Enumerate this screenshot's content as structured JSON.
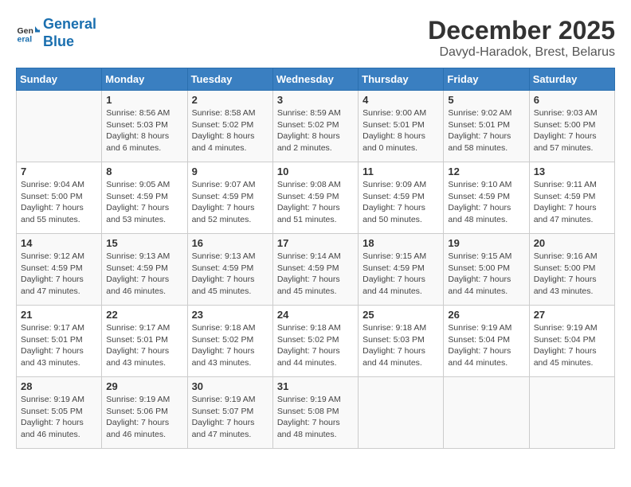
{
  "header": {
    "logo_line1": "General",
    "logo_line2": "Blue",
    "month": "December 2025",
    "location": "Davyd-Haradok, Brest, Belarus"
  },
  "days_of_week": [
    "Sunday",
    "Monday",
    "Tuesday",
    "Wednesday",
    "Thursday",
    "Friday",
    "Saturday"
  ],
  "weeks": [
    [
      {
        "day": "",
        "info": ""
      },
      {
        "day": "1",
        "info": "Sunrise: 8:56 AM\nSunset: 5:03 PM\nDaylight: 8 hours\nand 6 minutes."
      },
      {
        "day": "2",
        "info": "Sunrise: 8:58 AM\nSunset: 5:02 PM\nDaylight: 8 hours\nand 4 minutes."
      },
      {
        "day": "3",
        "info": "Sunrise: 8:59 AM\nSunset: 5:02 PM\nDaylight: 8 hours\nand 2 minutes."
      },
      {
        "day": "4",
        "info": "Sunrise: 9:00 AM\nSunset: 5:01 PM\nDaylight: 8 hours\nand 0 minutes."
      },
      {
        "day": "5",
        "info": "Sunrise: 9:02 AM\nSunset: 5:01 PM\nDaylight: 7 hours\nand 58 minutes."
      },
      {
        "day": "6",
        "info": "Sunrise: 9:03 AM\nSunset: 5:00 PM\nDaylight: 7 hours\nand 57 minutes."
      }
    ],
    [
      {
        "day": "7",
        "info": "Sunrise: 9:04 AM\nSunset: 5:00 PM\nDaylight: 7 hours\nand 55 minutes."
      },
      {
        "day": "8",
        "info": "Sunrise: 9:05 AM\nSunset: 4:59 PM\nDaylight: 7 hours\nand 53 minutes."
      },
      {
        "day": "9",
        "info": "Sunrise: 9:07 AM\nSunset: 4:59 PM\nDaylight: 7 hours\nand 52 minutes."
      },
      {
        "day": "10",
        "info": "Sunrise: 9:08 AM\nSunset: 4:59 PM\nDaylight: 7 hours\nand 51 minutes."
      },
      {
        "day": "11",
        "info": "Sunrise: 9:09 AM\nSunset: 4:59 PM\nDaylight: 7 hours\nand 50 minutes."
      },
      {
        "day": "12",
        "info": "Sunrise: 9:10 AM\nSunset: 4:59 PM\nDaylight: 7 hours\nand 48 minutes."
      },
      {
        "day": "13",
        "info": "Sunrise: 9:11 AM\nSunset: 4:59 PM\nDaylight: 7 hours\nand 47 minutes."
      }
    ],
    [
      {
        "day": "14",
        "info": "Sunrise: 9:12 AM\nSunset: 4:59 PM\nDaylight: 7 hours\nand 47 minutes."
      },
      {
        "day": "15",
        "info": "Sunrise: 9:13 AM\nSunset: 4:59 PM\nDaylight: 7 hours\nand 46 minutes."
      },
      {
        "day": "16",
        "info": "Sunrise: 9:13 AM\nSunset: 4:59 PM\nDaylight: 7 hours\nand 45 minutes."
      },
      {
        "day": "17",
        "info": "Sunrise: 9:14 AM\nSunset: 4:59 PM\nDaylight: 7 hours\nand 45 minutes."
      },
      {
        "day": "18",
        "info": "Sunrise: 9:15 AM\nSunset: 4:59 PM\nDaylight: 7 hours\nand 44 minutes."
      },
      {
        "day": "19",
        "info": "Sunrise: 9:15 AM\nSunset: 5:00 PM\nDaylight: 7 hours\nand 44 minutes."
      },
      {
        "day": "20",
        "info": "Sunrise: 9:16 AM\nSunset: 5:00 PM\nDaylight: 7 hours\nand 43 minutes."
      }
    ],
    [
      {
        "day": "21",
        "info": "Sunrise: 9:17 AM\nSunset: 5:01 PM\nDaylight: 7 hours\nand 43 minutes."
      },
      {
        "day": "22",
        "info": "Sunrise: 9:17 AM\nSunset: 5:01 PM\nDaylight: 7 hours\nand 43 minutes."
      },
      {
        "day": "23",
        "info": "Sunrise: 9:18 AM\nSunset: 5:02 PM\nDaylight: 7 hours\nand 43 minutes."
      },
      {
        "day": "24",
        "info": "Sunrise: 9:18 AM\nSunset: 5:02 PM\nDaylight: 7 hours\nand 44 minutes."
      },
      {
        "day": "25",
        "info": "Sunrise: 9:18 AM\nSunset: 5:03 PM\nDaylight: 7 hours\nand 44 minutes."
      },
      {
        "day": "26",
        "info": "Sunrise: 9:19 AM\nSunset: 5:04 PM\nDaylight: 7 hours\nand 44 minutes."
      },
      {
        "day": "27",
        "info": "Sunrise: 9:19 AM\nSunset: 5:04 PM\nDaylight: 7 hours\nand 45 minutes."
      }
    ],
    [
      {
        "day": "28",
        "info": "Sunrise: 9:19 AM\nSunset: 5:05 PM\nDaylight: 7 hours\nand 46 minutes."
      },
      {
        "day": "29",
        "info": "Sunrise: 9:19 AM\nSunset: 5:06 PM\nDaylight: 7 hours\nand 46 minutes."
      },
      {
        "day": "30",
        "info": "Sunrise: 9:19 AM\nSunset: 5:07 PM\nDaylight: 7 hours\nand 47 minutes."
      },
      {
        "day": "31",
        "info": "Sunrise: 9:19 AM\nSunset: 5:08 PM\nDaylight: 7 hours\nand 48 minutes."
      },
      {
        "day": "",
        "info": ""
      },
      {
        "day": "",
        "info": ""
      },
      {
        "day": "",
        "info": ""
      }
    ]
  ]
}
